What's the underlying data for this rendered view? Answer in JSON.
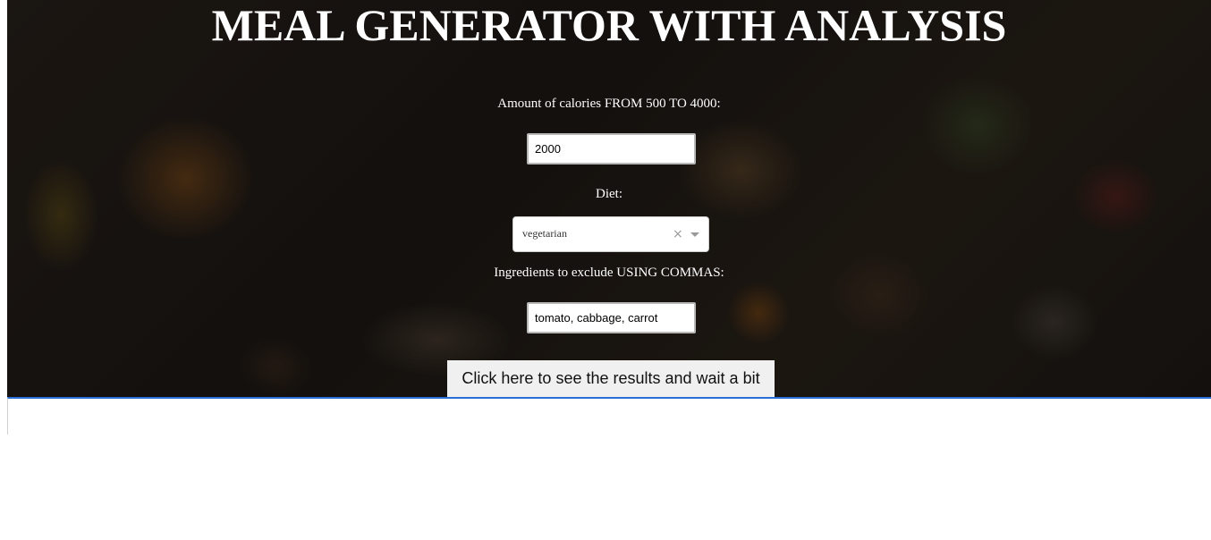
{
  "page": {
    "title": "MEAL GENERATOR WITH ANALYSIS"
  },
  "form": {
    "calories": {
      "label": "Amount of calories FROM 500 TO 4000:",
      "value": "2000"
    },
    "diet": {
      "label": "Diet:",
      "selected": "vegetarian",
      "clear_glyph": "×"
    },
    "exclude": {
      "label": "Ingredients to exclude USING COMMAS:",
      "value": "tomato, cabbage, carrot"
    },
    "submit_label": "Click here to see the results and wait a bit"
  },
  "icons": {
    "clear": "close-icon",
    "dropdown": "chevron-down-icon"
  },
  "colors": {
    "title_text": "#ffffff",
    "results_border": "#2a6fd6",
    "button_bg": "#f0f0f0"
  }
}
